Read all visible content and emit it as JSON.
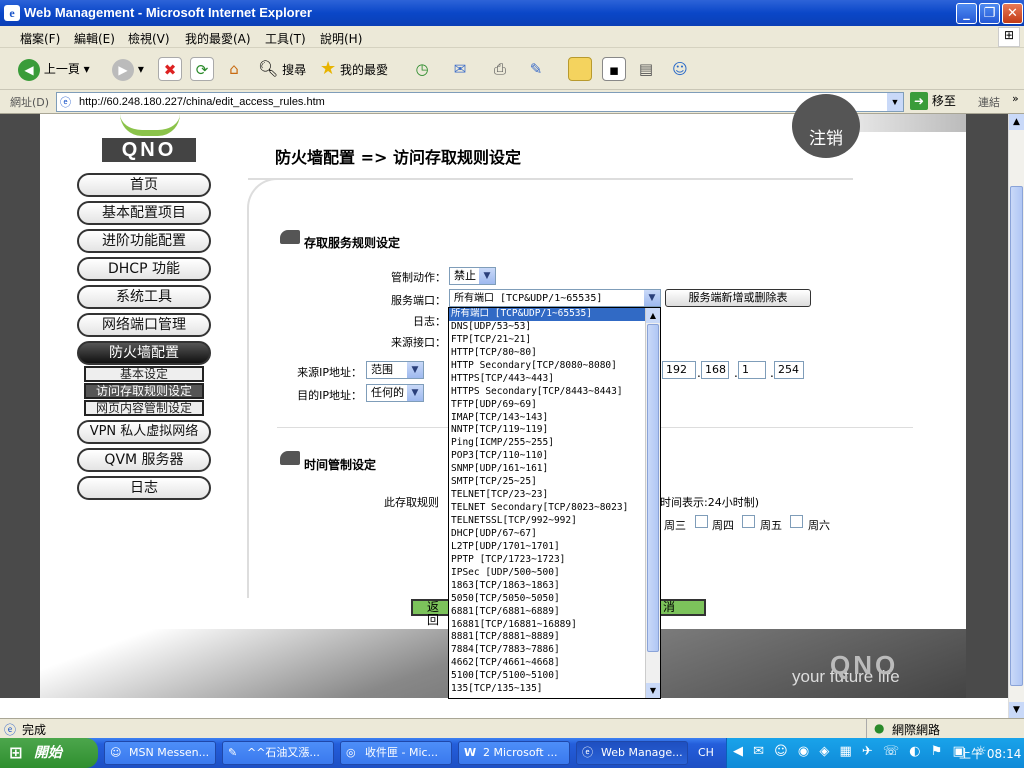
{
  "window": {
    "title": "Web Management - Microsoft Internet Explorer"
  },
  "menu": [
    "檔案(F)",
    "編輯(E)",
    "檢視(V)",
    "我的最愛(A)",
    "工具(T)",
    "說明(H)"
  ],
  "toolbar": {
    "back": "上一頁",
    "search": "搜尋",
    "favorites": "我的最愛"
  },
  "address": {
    "label": "網址(D)",
    "url": "http://60.248.180.227/china/edit_access_rules.htm",
    "go": "移至",
    "links": "連結"
  },
  "brand": {
    "logo": "QNO",
    "slogan": "your future life"
  },
  "logout": "注销",
  "page_title": "防火墙配置 => 访问存取规则设定",
  "nav": [
    {
      "label": "首页"
    },
    {
      "label": "基本配置项目"
    },
    {
      "label": "进阶功能配置"
    },
    {
      "label": "DHCP 功能"
    },
    {
      "label": "系统工具"
    },
    {
      "label": "网络端口管理"
    },
    {
      "label": "防火墙配置"
    }
  ],
  "subnav": [
    {
      "label": "基本设定"
    },
    {
      "label": "访问存取规则设定"
    },
    {
      "label": "网页内容管制设定"
    }
  ],
  "nav2": [
    {
      "label": "VPN 私人虚拟网络"
    },
    {
      "label": "QVM 服务器"
    },
    {
      "label": "日志"
    }
  ],
  "section1": {
    "title": "存取服务规则设定",
    "action_label": "管制动作：",
    "action_value": "禁止",
    "service_label": "服务端口：",
    "service_value": "所有端口 [TCP&UDP/1~65535]",
    "service_manage_btn": "服务端新增或删除表",
    "log_label": "日志：",
    "source_if_label": "来源接口：",
    "source_ip_label": "来源IP地址：",
    "source_ip_value": "范围",
    "dest_ip_label": "目的IP地址：",
    "dest_ip_value": "任何的",
    "ip_octets": [
      "192",
      "168",
      "1",
      "254"
    ]
  },
  "section2": {
    "title": "时间管制设定",
    "rule_label": "此存取规则",
    "time_hint": "时间表示:24小时制)",
    "days": [
      "周三",
      "周四",
      "周五",
      "周六"
    ]
  },
  "buttons": {
    "back": "返回",
    "cancel": "消"
  },
  "dropdown_options": [
    "所有端口 [TCP&UDP/1~65535]",
    "DNS[UDP/53~53]",
    "FTP[TCP/21~21]",
    "HTTP[TCP/80~80]",
    "HTTP Secondary[TCP/8080~8080]",
    "HTTPS[TCP/443~443]",
    "HTTPS Secondary[TCP/8443~8443]",
    "TFTP[UDP/69~69]",
    "IMAP[TCP/143~143]",
    "NNTP[TCP/119~119]",
    "Ping[ICMP/255~255]",
    "POP3[TCP/110~110]",
    "SNMP[UDP/161~161]",
    "SMTP[TCP/25~25]",
    "TELNET[TCP/23~23]",
    "TELNET Secondary[TCP/8023~8023]",
    "TELNETSSL[TCP/992~992]",
    "DHCP[UDP/67~67]",
    "L2TP[UDP/1701~1701]",
    "PPTP [TCP/1723~1723]",
    "IPSec [UDP/500~500]",
    "1863[TCP/1863~1863]",
    "5050[TCP/5050~5050]",
    "6881[TCP/6881~6889]",
    "16881[TCP/16881~16889]",
    "8881[TCP/8881~8889]",
    "7884[TCP/7883~7886]",
    "4662[TCP/4661~4668]",
    "5100[TCP/5100~5100]",
    "135[TCP/135~135]"
  ],
  "status": {
    "left": "完成",
    "zone": "網際網路"
  },
  "taskbar": {
    "start": "開始",
    "tasks": [
      "MSN Messen...",
      "^^石油又漲...",
      "收件匣 - Mic...",
      "2 Microsoft ...",
      "Web Manage..."
    ],
    "lang": "CH",
    "clock": "上午 08:14"
  },
  "colors": {
    "titlebar": "#0a47c8",
    "accent": "#316ac5",
    "green_button": "#7cc35b",
    "taskbar": "#245edb"
  }
}
